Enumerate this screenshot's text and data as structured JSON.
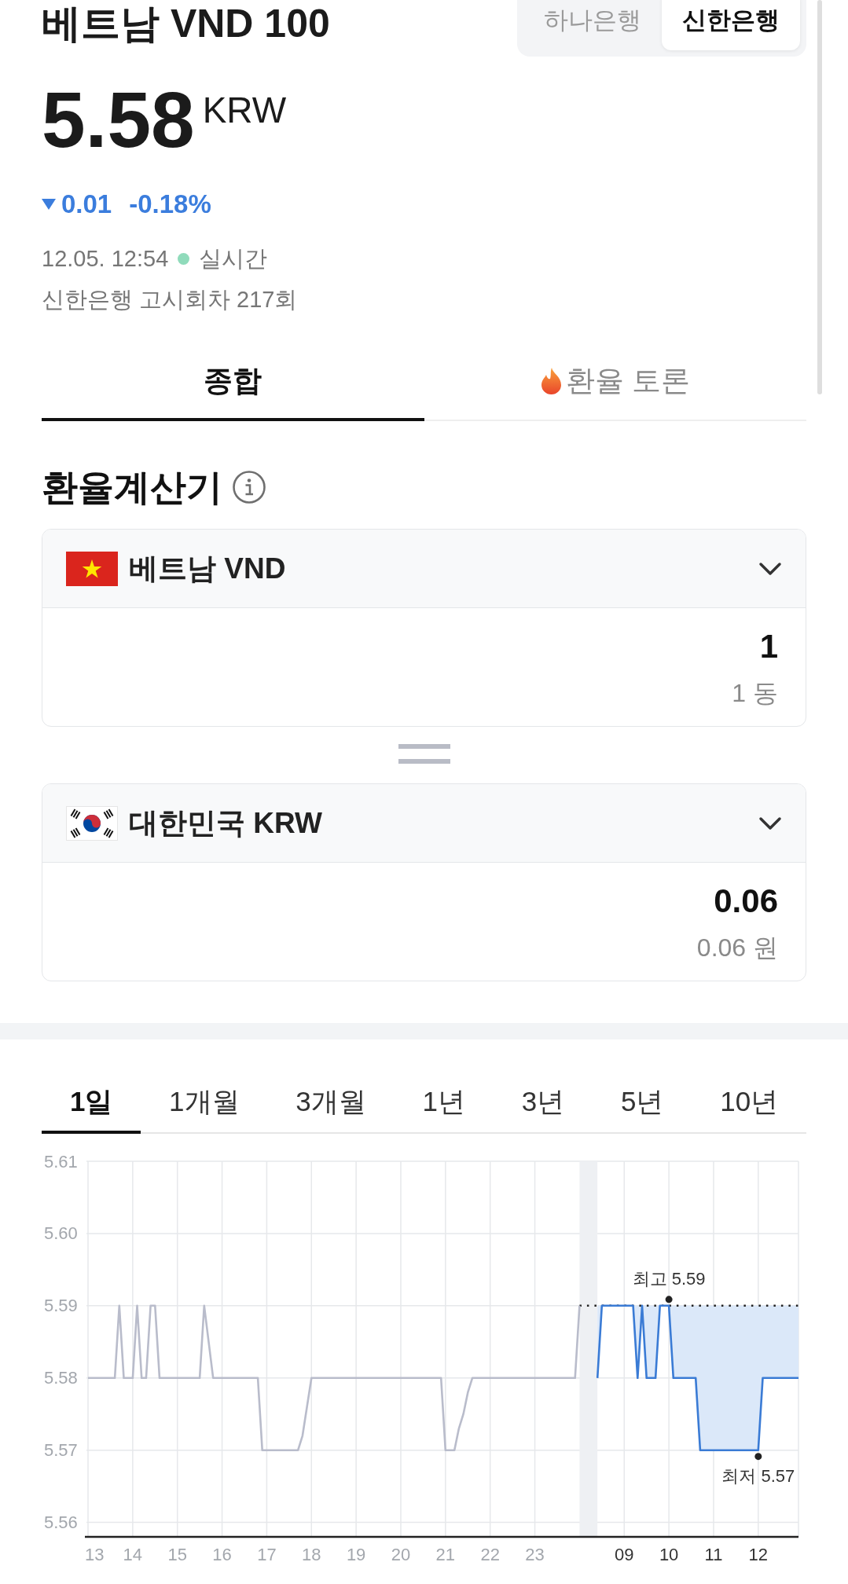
{
  "header": {
    "title": "베트남 VND 100",
    "banks": [
      {
        "label": "하나은행",
        "selected": false
      },
      {
        "label": "신한은행",
        "selected": true
      }
    ]
  },
  "quote": {
    "price": "5.58",
    "currency": "KRW",
    "falling": true,
    "change": "0.01",
    "change_percent": "-0.18%",
    "time": "12.05. 12:54",
    "live_label": "실시간",
    "notice": "신한은행 고시회차 217회"
  },
  "tabs": [
    {
      "label": "종합",
      "selected": true,
      "kind": "plain"
    },
    {
      "label": "환율 토론",
      "selected": false,
      "kind": "flame"
    }
  ],
  "calculator": {
    "title": "환율계산기",
    "currencies": [
      {
        "kind": "vietnam",
        "name": "베트남 VND",
        "amount": "1",
        "amount_text": "1 동"
      },
      {
        "kind": "korea",
        "name": "대한민국 KRW",
        "amount": "0.06",
        "amount_text": "0.06 원"
      }
    ]
  },
  "chart": {
    "periods": [
      {
        "label": "1일",
        "selected": true
      },
      {
        "label": "1개월",
        "selected": false
      },
      {
        "label": "3개월",
        "selected": false
      },
      {
        "label": "1년",
        "selected": false
      },
      {
        "label": "3년",
        "selected": false
      },
      {
        "label": "5년",
        "selected": false
      },
      {
        "label": "10년",
        "selected": false
      }
    ],
    "chart_data": {
      "type": "line",
      "grid": true,
      "categories": [
        "13",
        null,
        null,
        null,
        null,
        null,
        null,
        null,
        null,
        null,
        "14",
        null,
        null,
        null,
        null,
        null,
        null,
        null,
        null,
        null,
        "15",
        null,
        null,
        null,
        null,
        null,
        null,
        null,
        null,
        null,
        "16",
        null,
        null,
        null,
        null,
        null,
        null,
        null,
        null,
        null,
        "17",
        null,
        null,
        null,
        null,
        null,
        null,
        null,
        null,
        null,
        "18",
        null,
        null,
        null,
        null,
        null,
        null,
        null,
        null,
        null,
        "19",
        null,
        null,
        null,
        null,
        null,
        null,
        null,
        null,
        null,
        "20",
        null,
        null,
        null,
        null,
        null,
        null,
        null,
        null,
        null,
        "21",
        null,
        null,
        null,
        null,
        null,
        null,
        null,
        null,
        null,
        "22",
        null,
        null,
        null,
        null,
        null,
        null,
        null,
        null,
        null,
        "23",
        null,
        null,
        null,
        null,
        null,
        null,
        null,
        null,
        null,
        null,
        null,
        null,
        null,
        null,
        null,
        null,
        null,
        null,
        null,
        "09",
        null,
        null,
        null,
        null,
        null,
        null,
        null,
        null,
        null,
        "10",
        null,
        null,
        null,
        null,
        null,
        null,
        null,
        null,
        null,
        "11",
        null,
        null,
        null,
        null,
        null,
        null,
        null,
        null,
        null,
        "12",
        null,
        null,
        null,
        null,
        null,
        null,
        null,
        null,
        null
      ],
      "series": [
        {
          "color": "#b9bccb",
          "values": [
            5.58,
            5.58,
            5.58,
            5.58,
            5.58,
            5.58,
            5.58,
            5.59,
            5.58,
            5.58,
            5.58,
            5.59,
            5.58,
            5.58,
            5.59,
            5.59,
            5.58,
            5.58,
            5.58,
            5.58,
            5.58,
            5.58,
            5.58,
            5.58,
            5.58,
            5.58,
            5.59,
            5.585,
            5.58,
            5.58,
            5.58,
            5.58,
            5.58,
            5.58,
            5.58,
            5.58,
            5.58,
            5.58,
            5.58,
            5.57,
            5.57,
            5.57,
            5.57,
            5.57,
            5.57,
            5.57,
            5.57,
            5.57,
            5.572,
            5.576,
            5.58,
            5.58,
            5.58,
            5.58,
            5.58,
            5.58,
            5.58,
            5.58,
            5.58,
            5.58,
            5.58,
            5.58,
            5.58,
            5.58,
            5.58,
            5.58,
            5.58,
            5.58,
            5.58,
            5.58,
            5.58,
            5.58,
            5.58,
            5.58,
            5.58,
            5.58,
            5.58,
            5.58,
            5.58,
            5.58,
            5.57,
            5.57,
            5.57,
            5.573,
            5.575,
            5.578,
            5.58,
            5.58,
            5.58,
            5.58,
            5.58,
            5.58,
            5.58,
            5.58,
            5.58,
            5.58,
            5.58,
            5.58,
            5.58,
            5.58,
            5.58,
            5.58,
            5.58,
            5.58,
            5.58,
            5.58,
            5.58,
            5.58,
            5.58,
            5.58,
            5.59,
            null,
            null,
            null,
            null,
            null,
            null,
            null,
            null,
            null,
            null,
            null,
            null,
            null,
            null,
            null,
            null,
            null,
            null,
            null,
            null,
            null,
            null,
            null,
            null,
            null,
            null,
            null,
            null,
            null,
            null,
            null,
            null,
            null,
            null,
            null,
            null,
            null,
            null,
            null,
            null,
            null,
            null,
            null,
            null,
            null,
            null,
            null,
            null,
            null
          ]
        },
        {
          "color": "#3a7bd5",
          "values": [
            null,
            null,
            null,
            null,
            null,
            null,
            null,
            null,
            null,
            null,
            null,
            null,
            null,
            null,
            null,
            null,
            null,
            null,
            null,
            null,
            null,
            null,
            null,
            null,
            null,
            null,
            null,
            null,
            null,
            null,
            null,
            null,
            null,
            null,
            null,
            null,
            null,
            null,
            null,
            null,
            null,
            null,
            null,
            null,
            null,
            null,
            null,
            null,
            null,
            null,
            null,
            null,
            null,
            null,
            null,
            null,
            null,
            null,
            null,
            null,
            null,
            null,
            null,
            null,
            null,
            null,
            null,
            null,
            null,
            null,
            null,
            null,
            null,
            null,
            null,
            null,
            null,
            null,
            null,
            null,
            null,
            null,
            null,
            null,
            null,
            null,
            null,
            null,
            null,
            null,
            null,
            null,
            null,
            null,
            null,
            null,
            null,
            null,
            null,
            null,
            null,
            null,
            null,
            null,
            null,
            null,
            null,
            null,
            null,
            null,
            null,
            null,
            null,
            null,
            5.58,
            5.59,
            5.59,
            5.59,
            5.59,
            5.59,
            5.59,
            5.59,
            5.59,
            5.58,
            5.59,
            5.58,
            5.58,
            5.58,
            5.59,
            5.59,
            5.59,
            5.58,
            5.58,
            5.58,
            5.58,
            5.58,
            5.58,
            5.57,
            5.57,
            5.57,
            5.57,
            5.57,
            5.57,
            5.57,
            5.57,
            5.57,
            5.57,
            5.57,
            5.57,
            5.57,
            5.57,
            5.58,
            5.58,
            5.58,
            5.58,
            5.58,
            5.58,
            5.58,
            5.58,
            5.58
          ]
        }
      ],
      "ylim": [
        5.558,
        5.61
      ],
      "yticks": [
        {
          "value": 5.56,
          "label": "5.56"
        },
        {
          "value": 5.57,
          "label": "5.57"
        },
        {
          "value": 5.58,
          "label": "5.58"
        },
        {
          "value": 5.59,
          "label": "5.59"
        },
        {
          "value": 5.6,
          "label": "5.60"
        },
        {
          "value": 5.61,
          "label": "5.61"
        }
      ],
      "ref_lines": [
        {
          "axis": "y",
          "value": 5.59
        }
      ],
      "annotations": [
        {
          "x": "10",
          "y": 5.59,
          "text": "최고 5.59"
        },
        {
          "x": "12",
          "y": 5.57,
          "text": "최저 5.57"
        }
      ]
    }
  }
}
